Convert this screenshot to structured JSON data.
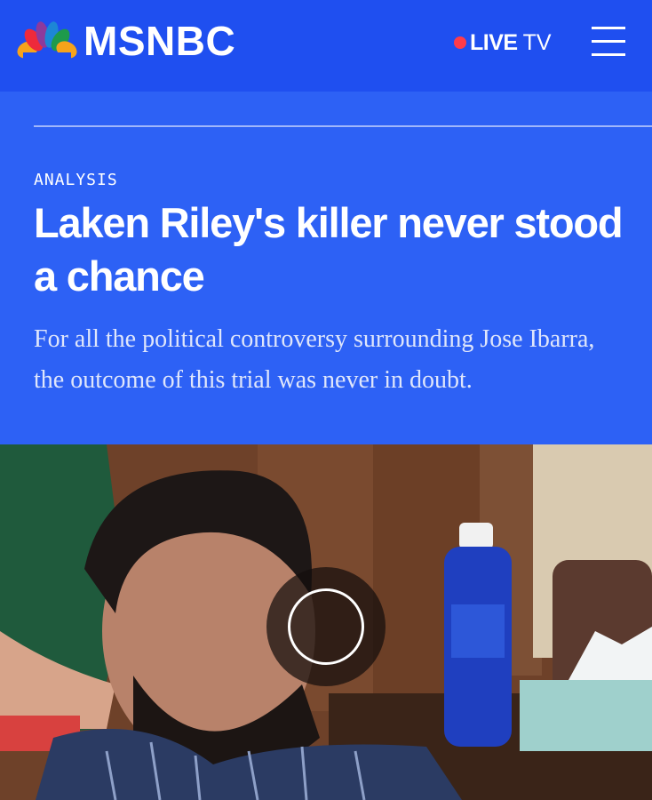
{
  "header": {
    "brand": "MSNBC",
    "live_strong": "LIVE",
    "live_light": "TV",
    "colors": {
      "bar": "#1f4ff0",
      "live_dot": "#ff3b4a"
    }
  },
  "article": {
    "kicker": "ANALYSIS",
    "headline": "Laken Riley's killer never stood a chance",
    "dek": "For all the political controversy surrounding Jose Ibarra, the outcome of this trial was never in doubt.",
    "colors": {
      "background": "#2d61f5"
    }
  },
  "media": {
    "icons": [
      "peacock-logo-icon",
      "menu-icon",
      "play-icon"
    ]
  }
}
